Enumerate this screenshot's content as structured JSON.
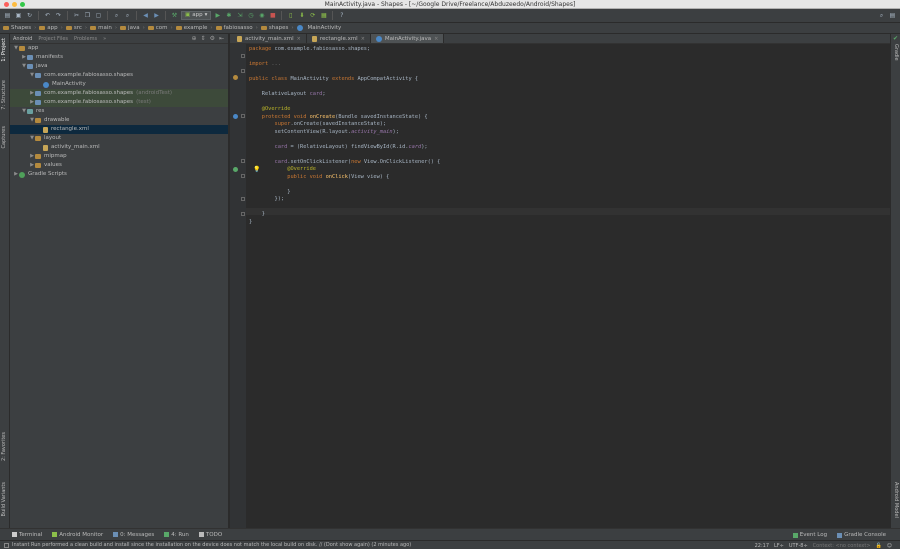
{
  "window": {
    "title": "MainActivity.java - Shapes - [~/Google Drive/Freelance/Abduzeedo/Android/Shapes]"
  },
  "toolbar": {
    "run_config": "app",
    "icons": [
      "open-icon",
      "save-icon",
      "sync-icon",
      "undo-icon",
      "redo-icon",
      "cut-icon",
      "copy-icon",
      "paste-icon",
      "find-icon",
      "replace-icon",
      "back-icon",
      "forward-icon",
      "build-icon",
      "run-icon",
      "debug-icon",
      "attach-icon",
      "profile-icon",
      "coverage-icon",
      "stop-icon",
      "avd-icon",
      "sdk-icon",
      "gradle-sync-icon",
      "monitor-icon",
      "help-icon"
    ]
  },
  "breadcrumbs": [
    "Shapes",
    "app",
    "src",
    "main",
    "java",
    "com",
    "example",
    "fabiosasso",
    "shapes",
    "MainActivity"
  ],
  "left_tabs": {
    "project": "1: Project",
    "structure": "7: Structure",
    "captures": "Captures",
    "favorites": "2: Favorites",
    "build_variants": "Build Variants"
  },
  "right_tabs": {
    "gradle": "Gradle",
    "android_model": "Android Model"
  },
  "project_panel": {
    "tabs": [
      "Android",
      "Project Files",
      "Problems"
    ],
    "tree": [
      {
        "label": "app",
        "indent": 0,
        "arrow": "▼",
        "icon": "tan-f"
      },
      {
        "label": "manifests",
        "indent": 1,
        "arrow": "▶",
        "icon": "blue-f"
      },
      {
        "label": "java",
        "indent": 1,
        "arrow": "▼",
        "icon": "blue-f"
      },
      {
        "label": "com.example.fabiosasso.shapes",
        "indent": 2,
        "arrow": "▼",
        "icon": "blue-f"
      },
      {
        "label": "MainActivity",
        "indent": 3,
        "arrow": "",
        "icon": "cls-i"
      },
      {
        "label": "com.example.fabiosasso.shapes",
        "suffix": "(androidTest)",
        "indent": 2,
        "arrow": "▶",
        "icon": "blue-f",
        "style": "green"
      },
      {
        "label": "com.example.fabiosasso.shapes",
        "suffix": "(test)",
        "indent": 2,
        "arrow": "▶",
        "icon": "blue-f",
        "style": "green"
      },
      {
        "label": "res",
        "indent": 1,
        "arrow": "▼",
        "icon": "teal-f"
      },
      {
        "label": "drawable",
        "indent": 2,
        "arrow": "▼",
        "icon": "tan-f"
      },
      {
        "label": "rectangle.xml",
        "indent": 3,
        "arrow": "",
        "icon": "xml-i",
        "style": "sel"
      },
      {
        "label": "layout",
        "indent": 2,
        "arrow": "▼",
        "icon": "tan-f"
      },
      {
        "label": "activity_main.xml",
        "indent": 3,
        "arrow": "",
        "icon": "xml-i"
      },
      {
        "label": "mipmap",
        "indent": 2,
        "arrow": "▶",
        "icon": "tan-f"
      },
      {
        "label": "values",
        "indent": 2,
        "arrow": "▶",
        "icon": "tan-f"
      },
      {
        "label": "Gradle Scripts",
        "indent": 0,
        "arrow": "▶",
        "icon": "grad-i"
      }
    ]
  },
  "editor": {
    "tabs": [
      {
        "label": "activity_main.xml",
        "active": false
      },
      {
        "label": "rectangle.xml",
        "active": false
      },
      {
        "label": "MainActivity.java",
        "active": true
      }
    ],
    "lines": [
      "<span class=\"kw\">package</span> com.example.fabiosasso.shapes;",
      "",
      "<span class=\"kw\">import</span> <span class=\"dim\">...</span>",
      "",
      "<span class=\"kw\">public class</span> MainActivity <span class=\"kw\">extends</span> AppCompatActivity {",
      "",
      "    RelativeLayout <span class=\"fld\">card</span>;",
      "",
      "    <span class=\"an\">@Override</span>",
      "    <span class=\"kw\">protected void</span> <span class=\"fn\">onCreate</span>(Bundle savedInstanceState) {",
      "        <span class=\"kw\">super</span>.onCreate(savedInstanceState);",
      "        setContentView(R.layout.<span class=\"it\">activity_main</span>);",
      "",
      "        <span class=\"fld\">card</span> = (RelativeLayout) findViewById(R.id.<span class=\"it\">card</span>);",
      "",
      "        <span class=\"fld\">card</span>.setOnClickListener(<span class=\"kw\">new</span> View.OnClickListener() {",
      "            <span class=\"an\">@Override</span>",
      "            <span class=\"kw\">public void</span> <span class=\"fn\">onClick</span>(View view) {",
      "",
      "            }",
      "        });",
      "",
      "    }",
      "}"
    ]
  },
  "bottom_tools": [
    {
      "label": "Terminal",
      "icon": "terminal-icon",
      "color": "#cccccc"
    },
    {
      "label": "Android Monitor",
      "icon": "android-monitor-icon",
      "color": "#8cbf4a"
    },
    {
      "label": "0: Messages",
      "icon": "messages-icon",
      "color": "#6b8fb5"
    },
    {
      "label": "4: Run",
      "icon": "run-tool-icon",
      "color": "#59a869"
    },
    {
      "label": "TODO",
      "icon": "todo-icon",
      "color": "#bbbbbb"
    }
  ],
  "bottom_right_tools": [
    {
      "label": "Event Log",
      "icon": "event-log-icon"
    },
    {
      "label": "Gradle Console",
      "icon": "gradle-console-icon"
    }
  ],
  "status": {
    "message": "Instant Run performed a clean build and install since the installation on the device does not match the local build on disk. // (Dont show again) (2 minutes ago)",
    "position": "22:17",
    "line_sep": "LF÷",
    "encoding": "UTF-8÷",
    "context": "Context: <no context>"
  },
  "colors": {
    "accent": "#4a88c7",
    "bg": "#2b2b2b",
    "panel": "#3c3f41",
    "keyword": "#cc7832"
  }
}
